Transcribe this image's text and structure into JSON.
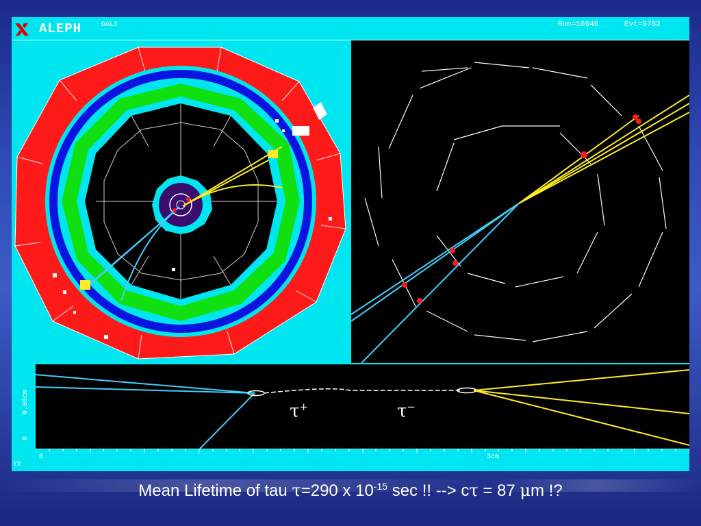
{
  "header": {
    "title": "ALEPH",
    "program": "DALI",
    "run": "Run=16946",
    "event": "Evt=9782"
  },
  "zoom_view": {
    "y_axis_label": "0.08cm",
    "y_tick_zero": "0",
    "x_tick_zero": "0",
    "x_tick_3": "3cm",
    "projection": "YX",
    "tau_plus": "τ",
    "tau_plus_sign": "+",
    "tau_minus": "τ",
    "tau_minus_sign": "−"
  },
  "caption": {
    "part1": "Mean Lifetime of tau ",
    "tau_symbol": "τ",
    "part2": "=290 x 10",
    "exponent": "-15",
    "part3": " sec !! -->  c",
    "tau_symbol2": "τ",
    "part4": " = 87 ",
    "mu_symbol": "μ",
    "part5": "m !?"
  },
  "colors": {
    "background_panel": "#00e6f0",
    "calorimeter_red": "#ff1a1a",
    "solenoid_blue": "#0a14e0",
    "ecal_green": "#10e010",
    "track_cyan": "#3fd0ff",
    "track_yellow": "#ffee22"
  }
}
